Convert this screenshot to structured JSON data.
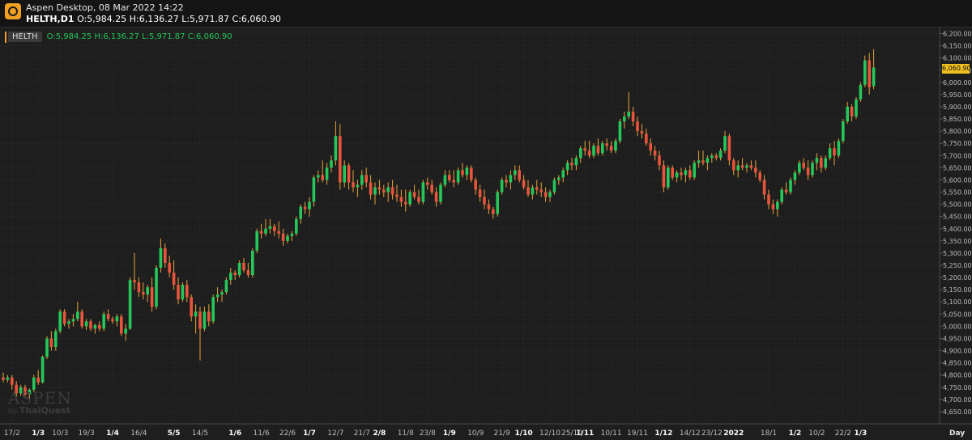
{
  "window": {
    "title": "Aspen Desktop, 08 Mar 2022 14:22",
    "symbol_tf": "HELTH,D1",
    "ohlc": "O:5,984.25 H:6,136.27 L:5,971.87 C:6,060.90"
  },
  "legend": {
    "symbol": "HELTH",
    "values": "O:5,984.25 H:6,136.27 L:5,971.87 C:6,060.90"
  },
  "price_tag": "6,060.90",
  "watermark": {
    "main": "ASPEN",
    "by": "by",
    "brand": "ThaiQuest"
  },
  "colors": {
    "up": "#26c75a",
    "down": "#e8543c",
    "wick": "#e8a33a",
    "price_tag": "#f0c020",
    "background": "#1e1e1e"
  },
  "chart_data": {
    "type": "candlestick",
    "timeframe_label": "Day",
    "ylim": [
      4600,
      6225
    ],
    "y_ticks": [
      "4,650.00",
      "4,700.00",
      "4,750.00",
      "4,800.00",
      "4,850.00",
      "4,900.00",
      "4,950.00",
      "5,000.00",
      "5,050.00",
      "5,100.00",
      "5,150.00",
      "5,200.00",
      "5,250.00",
      "5,300.00",
      "5,350.00",
      "5,400.00",
      "5,450.00",
      "5,500.00",
      "5,550.00",
      "5,600.00",
      "5,650.00",
      "5,700.00",
      "5,750.00",
      "5,800.00",
      "5,850.00",
      "5,900.00",
      "5,950.00",
      "6,000.00",
      "6,050.00",
      "6,100.00",
      "6,150.00",
      "6,200.00"
    ],
    "x_ticks": [
      {
        "i": 2,
        "label": "17/2",
        "bold": false
      },
      {
        "i": 8,
        "label": "1/3",
        "bold": true
      },
      {
        "i": 13,
        "label": "10/3",
        "bold": false
      },
      {
        "i": 19,
        "label": "19/3",
        "bold": false
      },
      {
        "i": 25,
        "label": "1/4",
        "bold": true
      },
      {
        "i": 31,
        "label": "16/4",
        "bold": false
      },
      {
        "i": 39,
        "label": "5/5",
        "bold": true
      },
      {
        "i": 45,
        "label": "14/5",
        "bold": false
      },
      {
        "i": 53,
        "label": "1/6",
        "bold": true
      },
      {
        "i": 59,
        "label": "11/6",
        "bold": false
      },
      {
        "i": 65,
        "label": "22/6",
        "bold": false
      },
      {
        "i": 70,
        "label": "1/7",
        "bold": true
      },
      {
        "i": 76,
        "label": "12/7",
        "bold": false
      },
      {
        "i": 82,
        "label": "21/7",
        "bold": false
      },
      {
        "i": 86,
        "label": "2/8",
        "bold": true
      },
      {
        "i": 92,
        "label": "11/8",
        "bold": false
      },
      {
        "i": 97,
        "label": "23/8",
        "bold": false
      },
      {
        "i": 102,
        "label": "1/9",
        "bold": true
      },
      {
        "i": 108,
        "label": "10/9",
        "bold": false
      },
      {
        "i": 114,
        "label": "21/9",
        "bold": false
      },
      {
        "i": 119,
        "label": "1/10",
        "bold": true
      },
      {
        "i": 125,
        "label": "12/10",
        "bold": false
      },
      {
        "i": 130,
        "label": "25/10",
        "bold": false
      },
      {
        "i": 133,
        "label": "1/11",
        "bold": true
      },
      {
        "i": 139,
        "label": "10/11",
        "bold": false
      },
      {
        "i": 145,
        "label": "19/11",
        "bold": false
      },
      {
        "i": 151,
        "label": "1/12",
        "bold": true
      },
      {
        "i": 157,
        "label": "14/12",
        "bold": false
      },
      {
        "i": 162,
        "label": "23/12",
        "bold": false
      },
      {
        "i": 167,
        "label": "2022",
        "bold": true
      },
      {
        "i": 175,
        "label": "18/1",
        "bold": false
      },
      {
        "i": 181,
        "label": "1/2",
        "bold": true
      },
      {
        "i": 186,
        "label": "10/2",
        "bold": false
      },
      {
        "i": 192,
        "label": "22/2",
        "bold": false
      },
      {
        "i": 196,
        "label": "1/3",
        "bold": true
      }
    ],
    "ohlc": [
      [
        4790,
        4810,
        4770,
        4780
      ],
      [
        4780,
        4800,
        4770,
        4790
      ],
      [
        4790,
        4800,
        4740,
        4760
      ],
      [
        4760,
        4775,
        4710,
        4725
      ],
      [
        4725,
        4760,
        4715,
        4750
      ],
      [
        4750,
        4760,
        4715,
        4720
      ],
      [
        4720,
        4745,
        4700,
        4740
      ],
      [
        4740,
        4800,
        4730,
        4790
      ],
      [
        4790,
        4820,
        4760,
        4770
      ],
      [
        4770,
        4880,
        4765,
        4875
      ],
      [
        4875,
        4960,
        4865,
        4950
      ],
      [
        4950,
        4980,
        4900,
        4915
      ],
      [
        4915,
        4990,
        4900,
        4980
      ],
      [
        4980,
        5070,
        4970,
        5060
      ],
      [
        5060,
        5070,
        5000,
        5010
      ],
      [
        5010,
        5030,
        4990,
        5020
      ],
      [
        5020,
        5050,
        5000,
        5030
      ],
      [
        5030,
        5100,
        5020,
        5060
      ],
      [
        5060,
        5070,
        4990,
        5000
      ],
      [
        5000,
        5030,
        4985,
        5020
      ],
      [
        5020,
        5030,
        4980,
        4990
      ],
      [
        4990,
        5010,
        4970,
        5005
      ],
      [
        5005,
        5020,
        4980,
        4990
      ],
      [
        4990,
        5060,
        4980,
        5050
      ],
      [
        5050,
        5070,
        5020,
        5030
      ],
      [
        5030,
        5040,
        5010,
        5020
      ],
      [
        5020,
        5050,
        5000,
        5040
      ],
      [
        5040,
        5050,
        4960,
        4970
      ],
      [
        4970,
        5010,
        4940,
        4990
      ],
      [
        4990,
        5200,
        4985,
        5190
      ],
      [
        5190,
        5300,
        5150,
        5180
      ],
      [
        5180,
        5200,
        5120,
        5140
      ],
      [
        5140,
        5180,
        5110,
        5130
      ],
      [
        5130,
        5170,
        5100,
        5160
      ],
      [
        5160,
        5200,
        5060,
        5080
      ],
      [
        5080,
        5250,
        5070,
        5240
      ],
      [
        5240,
        5360,
        5220,
        5320
      ],
      [
        5320,
        5340,
        5240,
        5260
      ],
      [
        5260,
        5290,
        5200,
        5220
      ],
      [
        5220,
        5270,
        5150,
        5170
      ],
      [
        5170,
        5200,
        5090,
        5110
      ],
      [
        5110,
        5180,
        5100,
        5170
      ],
      [
        5170,
        5190,
        5100,
        5120
      ],
      [
        5120,
        5130,
        5020,
        5040
      ],
      [
        5040,
        5090,
        4970,
        5060
      ],
      [
        5060,
        5080,
        4860,
        4990
      ],
      [
        4990,
        5080,
        4980,
        5060
      ],
      [
        5060,
        5090,
        5000,
        5020
      ],
      [
        5020,
        5130,
        5010,
        5120
      ],
      [
        5120,
        5160,
        5100,
        5130
      ],
      [
        5130,
        5150,
        5100,
        5140
      ],
      [
        5140,
        5200,
        5130,
        5190
      ],
      [
        5190,
        5240,
        5170,
        5220
      ],
      [
        5220,
        5230,
        5190,
        5210
      ],
      [
        5210,
        5270,
        5200,
        5260
      ],
      [
        5260,
        5280,
        5220,
        5230
      ],
      [
        5230,
        5260,
        5200,
        5210
      ],
      [
        5210,
        5320,
        5200,
        5310
      ],
      [
        5310,
        5400,
        5300,
        5390
      ],
      [
        5390,
        5420,
        5360,
        5380
      ],
      [
        5380,
        5440,
        5370,
        5400
      ],
      [
        5400,
        5440,
        5380,
        5410
      ],
      [
        5410,
        5420,
        5370,
        5390
      ],
      [
        5390,
        5430,
        5360,
        5380
      ],
      [
        5380,
        5400,
        5330,
        5350
      ],
      [
        5350,
        5380,
        5340,
        5370
      ],
      [
        5370,
        5390,
        5350,
        5380
      ],
      [
        5380,
        5450,
        5370,
        5440
      ],
      [
        5440,
        5500,
        5420,
        5490
      ],
      [
        5490,
        5510,
        5460,
        5480
      ],
      [
        5480,
        5530,
        5450,
        5510
      ],
      [
        5510,
        5620,
        5490,
        5610
      ],
      [
        5610,
        5640,
        5590,
        5620
      ],
      [
        5620,
        5680,
        5590,
        5600
      ],
      [
        5600,
        5670,
        5580,
        5650
      ],
      [
        5650,
        5700,
        5630,
        5680
      ],
      [
        5680,
        5840,
        5660,
        5780
      ],
      [
        5780,
        5830,
        5560,
        5590
      ],
      [
        5590,
        5680,
        5570,
        5660
      ],
      [
        5660,
        5670,
        5560,
        5590
      ],
      [
        5590,
        5640,
        5550,
        5570
      ],
      [
        5570,
        5600,
        5530,
        5580
      ],
      [
        5580,
        5640,
        5560,
        5620
      ],
      [
        5620,
        5650,
        5570,
        5590
      ],
      [
        5590,
        5620,
        5520,
        5540
      ],
      [
        5540,
        5590,
        5500,
        5570
      ],
      [
        5570,
        5600,
        5540,
        5560
      ],
      [
        5560,
        5580,
        5530,
        5550
      ],
      [
        5550,
        5590,
        5510,
        5570
      ],
      [
        5570,
        5600,
        5520,
        5540
      ],
      [
        5540,
        5580,
        5510,
        5530
      ],
      [
        5530,
        5560,
        5490,
        5510
      ],
      [
        5510,
        5560,
        5470,
        5500
      ],
      [
        5500,
        5560,
        5490,
        5550
      ],
      [
        5550,
        5580,
        5520,
        5530
      ],
      [
        5530,
        5560,
        5500,
        5510
      ],
      [
        5510,
        5600,
        5500,
        5590
      ],
      [
        5590,
        5610,
        5560,
        5580
      ],
      [
        5580,
        5600,
        5540,
        5550
      ],
      [
        5550,
        5570,
        5490,
        5510
      ],
      [
        5510,
        5590,
        5500,
        5580
      ],
      [
        5580,
        5640,
        5570,
        5620
      ],
      [
        5620,
        5640,
        5590,
        5600
      ],
      [
        5600,
        5640,
        5570,
        5590
      ],
      [
        5590,
        5650,
        5580,
        5640
      ],
      [
        5640,
        5670,
        5610,
        5620
      ],
      [
        5620,
        5660,
        5600,
        5650
      ],
      [
        5650,
        5660,
        5590,
        5600
      ],
      [
        5600,
        5610,
        5540,
        5560
      ],
      [
        5560,
        5580,
        5510,
        5530
      ],
      [
        5530,
        5560,
        5480,
        5500
      ],
      [
        5500,
        5520,
        5460,
        5480
      ],
      [
        5480,
        5490,
        5440,
        5460
      ],
      [
        5460,
        5560,
        5450,
        5550
      ],
      [
        5550,
        5610,
        5540,
        5600
      ],
      [
        5600,
        5620,
        5570,
        5590
      ],
      [
        5590,
        5640,
        5560,
        5620
      ],
      [
        5620,
        5660,
        5600,
        5640
      ],
      [
        5640,
        5660,
        5590,
        5600
      ],
      [
        5600,
        5620,
        5560,
        5570
      ],
      [
        5570,
        5600,
        5530,
        5540
      ],
      [
        5540,
        5580,
        5520,
        5570
      ],
      [
        5570,
        5600,
        5540,
        5560
      ],
      [
        5560,
        5590,
        5530,
        5550
      ],
      [
        5550,
        5570,
        5510,
        5530
      ],
      [
        5530,
        5560,
        5510,
        5550
      ],
      [
        5550,
        5610,
        5540,
        5600
      ],
      [
        5600,
        5620,
        5580,
        5610
      ],
      [
        5610,
        5650,
        5590,
        5640
      ],
      [
        5640,
        5680,
        5620,
        5670
      ],
      [
        5670,
        5690,
        5640,
        5660
      ],
      [
        5660,
        5700,
        5640,
        5690
      ],
      [
        5690,
        5740,
        5670,
        5730
      ],
      [
        5730,
        5760,
        5700,
        5720
      ],
      [
        5720,
        5760,
        5690,
        5700
      ],
      [
        5700,
        5750,
        5690,
        5740
      ],
      [
        5740,
        5770,
        5700,
        5710
      ],
      [
        5710,
        5760,
        5700,
        5750
      ],
      [
        5750,
        5770,
        5720,
        5740
      ],
      [
        5740,
        5760,
        5710,
        5720
      ],
      [
        5720,
        5770,
        5710,
        5760
      ],
      [
        5760,
        5850,
        5750,
        5840
      ],
      [
        5840,
        5880,
        5810,
        5860
      ],
      [
        5860,
        5960,
        5850,
        5880
      ],
      [
        5880,
        5900,
        5820,
        5840
      ],
      [
        5840,
        5860,
        5780,
        5800
      ],
      [
        5800,
        5830,
        5770,
        5790
      ],
      [
        5790,
        5810,
        5740,
        5750
      ],
      [
        5750,
        5770,
        5700,
        5720
      ],
      [
        5720,
        5740,
        5680,
        5700
      ],
      [
        5700,
        5720,
        5640,
        5660
      ],
      [
        5660,
        5680,
        5550,
        5570
      ],
      [
        5570,
        5660,
        5560,
        5650
      ],
      [
        5650,
        5660,
        5600,
        5610
      ],
      [
        5610,
        5640,
        5590,
        5630
      ],
      [
        5630,
        5650,
        5600,
        5620
      ],
      [
        5620,
        5650,
        5590,
        5640
      ],
      [
        5640,
        5660,
        5600,
        5610
      ],
      [
        5610,
        5680,
        5600,
        5670
      ],
      [
        5670,
        5720,
        5650,
        5680
      ],
      [
        5680,
        5720,
        5660,
        5670
      ],
      [
        5670,
        5700,
        5640,
        5690
      ],
      [
        5690,
        5710,
        5670,
        5700
      ],
      [
        5700,
        5710,
        5680,
        5690
      ],
      [
        5690,
        5730,
        5680,
        5720
      ],
      [
        5720,
        5800,
        5710,
        5780
      ],
      [
        5780,
        5790,
        5660,
        5680
      ],
      [
        5680,
        5690,
        5620,
        5640
      ],
      [
        5640,
        5680,
        5610,
        5660
      ],
      [
        5660,
        5690,
        5640,
        5650
      ],
      [
        5650,
        5670,
        5630,
        5660
      ],
      [
        5660,
        5680,
        5640,
        5650
      ],
      [
        5650,
        5680,
        5610,
        5630
      ],
      [
        5630,
        5640,
        5590,
        5600
      ],
      [
        5600,
        5620,
        5520,
        5540
      ],
      [
        5540,
        5560,
        5480,
        5500
      ],
      [
        5500,
        5520,
        5460,
        5480
      ],
      [
        5480,
        5520,
        5450,
        5510
      ],
      [
        5510,
        5570,
        5500,
        5560
      ],
      [
        5560,
        5590,
        5540,
        5550
      ],
      [
        5550,
        5610,
        5540,
        5600
      ],
      [
        5600,
        5640,
        5580,
        5630
      ],
      [
        5630,
        5680,
        5620,
        5670
      ],
      [
        5670,
        5690,
        5640,
        5650
      ],
      [
        5650,
        5680,
        5600,
        5620
      ],
      [
        5620,
        5680,
        5610,
        5670
      ],
      [
        5670,
        5710,
        5640,
        5690
      ],
      [
        5690,
        5700,
        5630,
        5650
      ],
      [
        5650,
        5700,
        5640,
        5690
      ],
      [
        5690,
        5750,
        5680,
        5730
      ],
      [
        5730,
        5760,
        5660,
        5700
      ],
      [
        5700,
        5770,
        5690,
        5760
      ],
      [
        5760,
        5850,
        5750,
        5840
      ],
      [
        5840,
        5920,
        5830,
        5900
      ],
      [
        5900,
        5910,
        5840,
        5860
      ],
      [
        5860,
        5940,
        5850,
        5930
      ],
      [
        5930,
        6000,
        5920,
        5990
      ],
      [
        5990,
        6110,
        5980,
        6090
      ],
      [
        6090,
        6120,
        5950,
        5980
      ],
      [
        5984.25,
        6136.27,
        5971.87,
        6060.9
      ]
    ]
  }
}
